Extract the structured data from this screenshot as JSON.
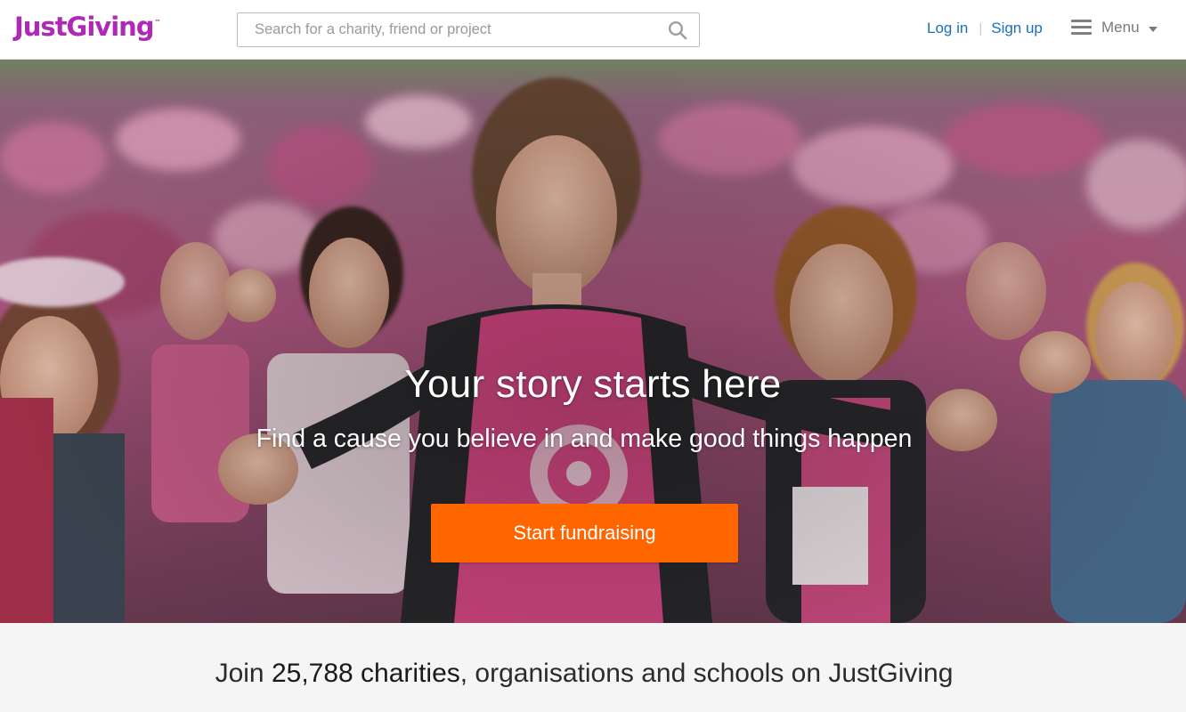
{
  "header": {
    "logo_text": "JustGiving",
    "logo_mark": "™",
    "search_placeholder": "Search for a charity, friend or project",
    "login_label": "Log in",
    "separator": "|",
    "signup_label": "Sign up",
    "menu_label": "Menu"
  },
  "hero": {
    "title": "Your story starts here",
    "subtitle": "Find a cause you believe in and make good things happen",
    "cta_label": "Start fundraising"
  },
  "join": {
    "prefix": "Join",
    "count": "25,788 charities",
    "suffix": ", organisations and schools on JustGiving"
  },
  "colors": {
    "brand_purple": "#ad29b6",
    "link_blue": "#1a6fb8",
    "cta_orange": "#ff6600"
  },
  "icons": [
    "search-icon",
    "hamburger-icon",
    "chevron-down-icon"
  ]
}
